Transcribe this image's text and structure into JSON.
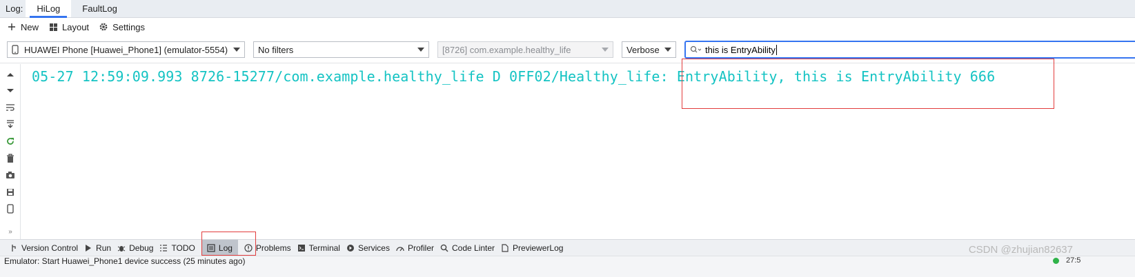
{
  "log_tabs": {
    "label": "Log:",
    "items": [
      {
        "label": "HiLog",
        "active": true
      },
      {
        "label": "FaultLog",
        "active": false
      }
    ]
  },
  "actions": {
    "new_label": "New",
    "layout_label": "Layout",
    "settings_label": "Settings"
  },
  "filters": {
    "device": "HUAWEI Phone [Huawei_Phone1] (emulator-5554)",
    "filter_preset": "No filters",
    "process": "[8726] com.example.healthy_life",
    "level": "Verbose",
    "search_value": "this is EntryAbility"
  },
  "log": {
    "lines": [
      "05-27 12:59:09.993 8726-15277/com.example.healthy_life D 0FF02/Healthy_life: EntryAbility, this is EntryAbility 666"
    ]
  },
  "bottom_tools": [
    {
      "label": "Version Control",
      "icon": "version-control-icon",
      "active": false
    },
    {
      "label": "Run",
      "icon": "run-icon",
      "active": false
    },
    {
      "label": "Debug",
      "icon": "bug-icon",
      "active": false
    },
    {
      "label": "TODO",
      "icon": "list-icon",
      "active": false
    },
    {
      "label": "Log",
      "icon": "log-icon",
      "active": true
    },
    {
      "label": "Problems",
      "icon": "problems-icon",
      "active": false
    },
    {
      "label": "Terminal",
      "icon": "terminal-icon",
      "active": false
    },
    {
      "label": "Services",
      "icon": "services-icon",
      "active": false
    },
    {
      "label": "Profiler",
      "icon": "profiler-icon",
      "active": false
    },
    {
      "label": "Code Linter",
      "icon": "search-icon",
      "active": false
    },
    {
      "label": "PreviewerLog",
      "icon": "file-icon",
      "active": false
    }
  ],
  "status": {
    "message": "Emulator: Start Huawei_Phone1 device success (25 minutes ago)",
    "time": "27:5"
  },
  "watermark": "CSDN @zhujian82637",
  "colors": {
    "log_text": "#14c3c3",
    "highlight_box": "#e23b3b",
    "accent": "#3574f0"
  }
}
